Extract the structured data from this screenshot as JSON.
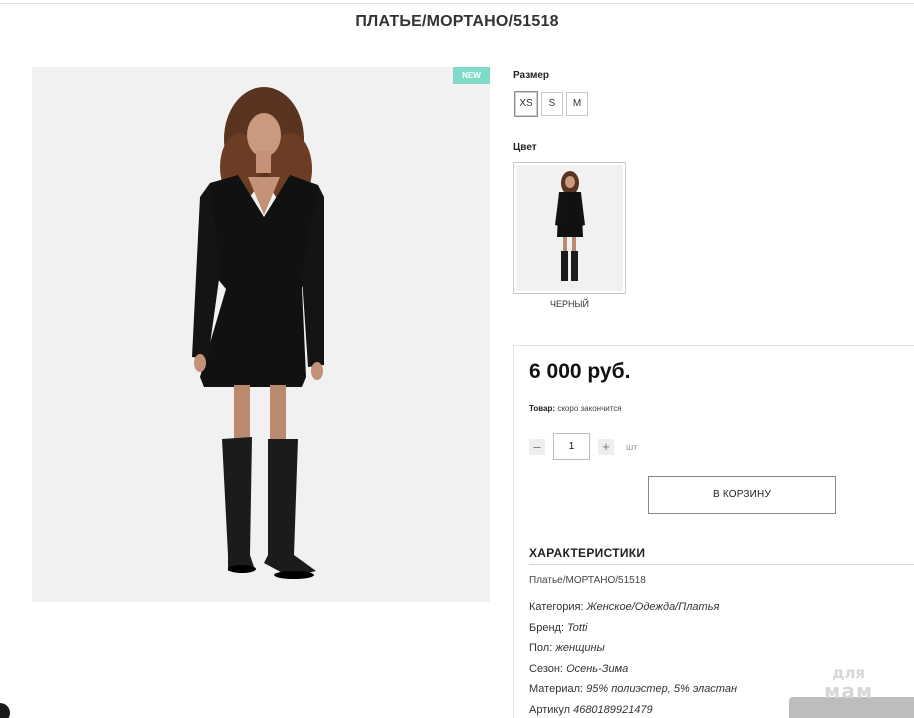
{
  "product": {
    "title": "ПЛАТЬЕ/МОРТАНО/51518",
    "badge": "NEW"
  },
  "options": {
    "size_label": "Размер",
    "sizes": [
      "XS",
      "S",
      "M"
    ],
    "selected_size": "XS",
    "color_label": "Цвет",
    "color_name": "ЧЕРНЫЙ"
  },
  "purchase": {
    "price": "6 000 руб.",
    "stock_label": "Товар:",
    "stock_value": "скоро закончится",
    "quantity": "1",
    "minus": "–",
    "plus": "+",
    "unit": "шт",
    "cart_button": "В КОРЗИНУ"
  },
  "characteristics": {
    "heading": "ХАРАКТЕРИСТИКИ",
    "name": "Платье/МОРТАНО/51518",
    "rows": [
      {
        "label": "Категория:",
        "value": "Женское/Одежда/Платья"
      },
      {
        "label": "Бренд:",
        "value": "Totti"
      },
      {
        "label": "Пол:",
        "value": "женщины"
      },
      {
        "label": "Сезон:",
        "value": "Осень-Зима"
      },
      {
        "label": "Материал:",
        "value": "95% полиэстер, 5% эластан"
      },
      {
        "label": "Артикул",
        "value": "4680189921479"
      }
    ]
  },
  "watermark": {
    "line1": "для",
    "line2": "мам"
  },
  "colors": {
    "badge": "#7fdbc7",
    "photo_bg": "#f1f1f1",
    "dress": "#111111"
  }
}
